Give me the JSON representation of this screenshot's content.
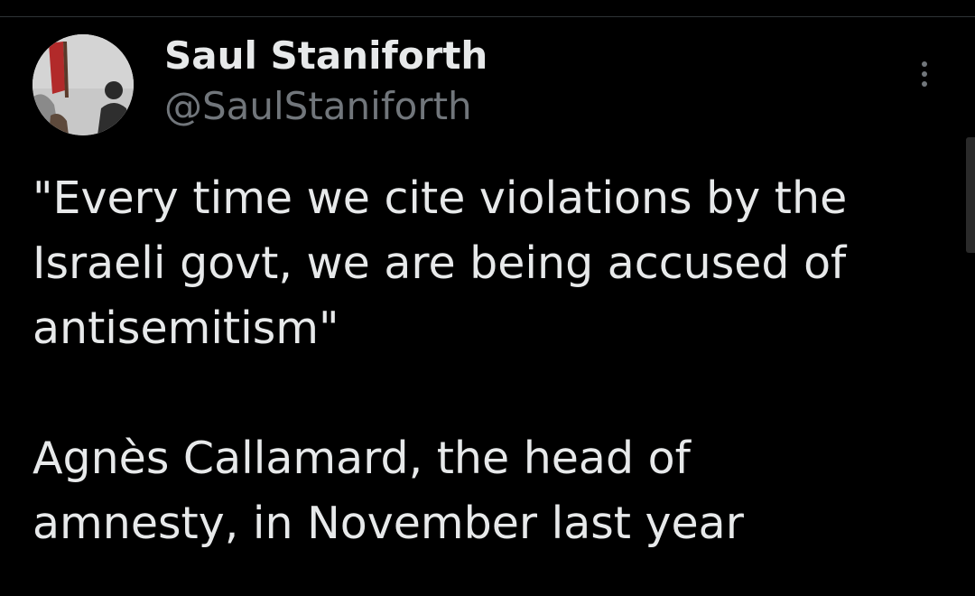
{
  "author": {
    "display_name": "Saul Staniforth",
    "handle": "@SaulStaniforth"
  },
  "tweet": {
    "paragraph_1": "\"Every time we cite violations by the\nIsraeli govt, we are being accused of\nantisemitism\"",
    "paragraph_2": "Agnès Callamard, the head of\namnesty, in November last year"
  },
  "icons": {
    "more": "more-options-icon"
  },
  "colors": {
    "background": "#000000",
    "primary_text": "#e7e9ea",
    "secondary_text": "#71767b"
  }
}
